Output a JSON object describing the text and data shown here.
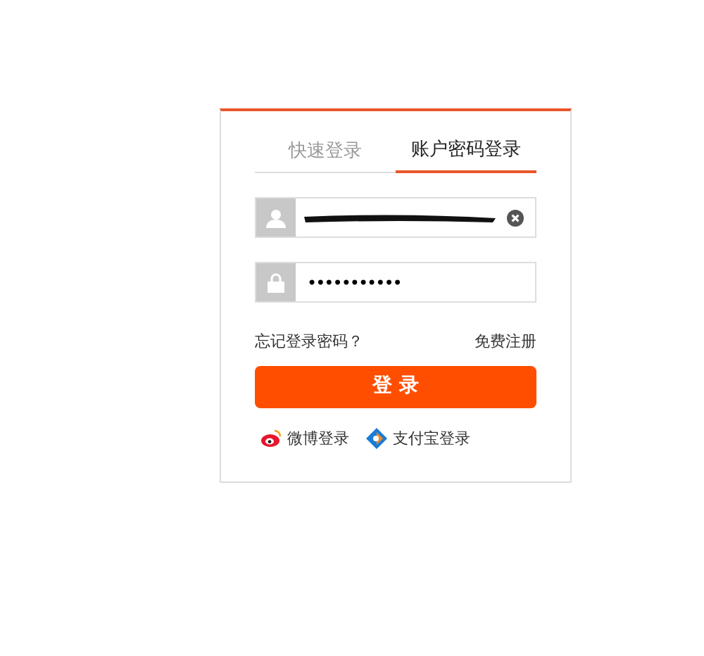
{
  "tabs": [
    {
      "label": "快速登录",
      "selected": false
    },
    {
      "label": "账户密码登录",
      "selected": true
    }
  ],
  "fields": [
    {
      "kind": "username"
    },
    {
      "kind": "password",
      "value": "•••••••••••"
    }
  ],
  "links": [
    "忘记登录密码？",
    "免费注册"
  ],
  "login_button": "登 录",
  "social": [
    {
      "kind": "weibo",
      "label": "微博登录"
    },
    {
      "kind": "alipay",
      "label": "支付宝登录"
    }
  ]
}
